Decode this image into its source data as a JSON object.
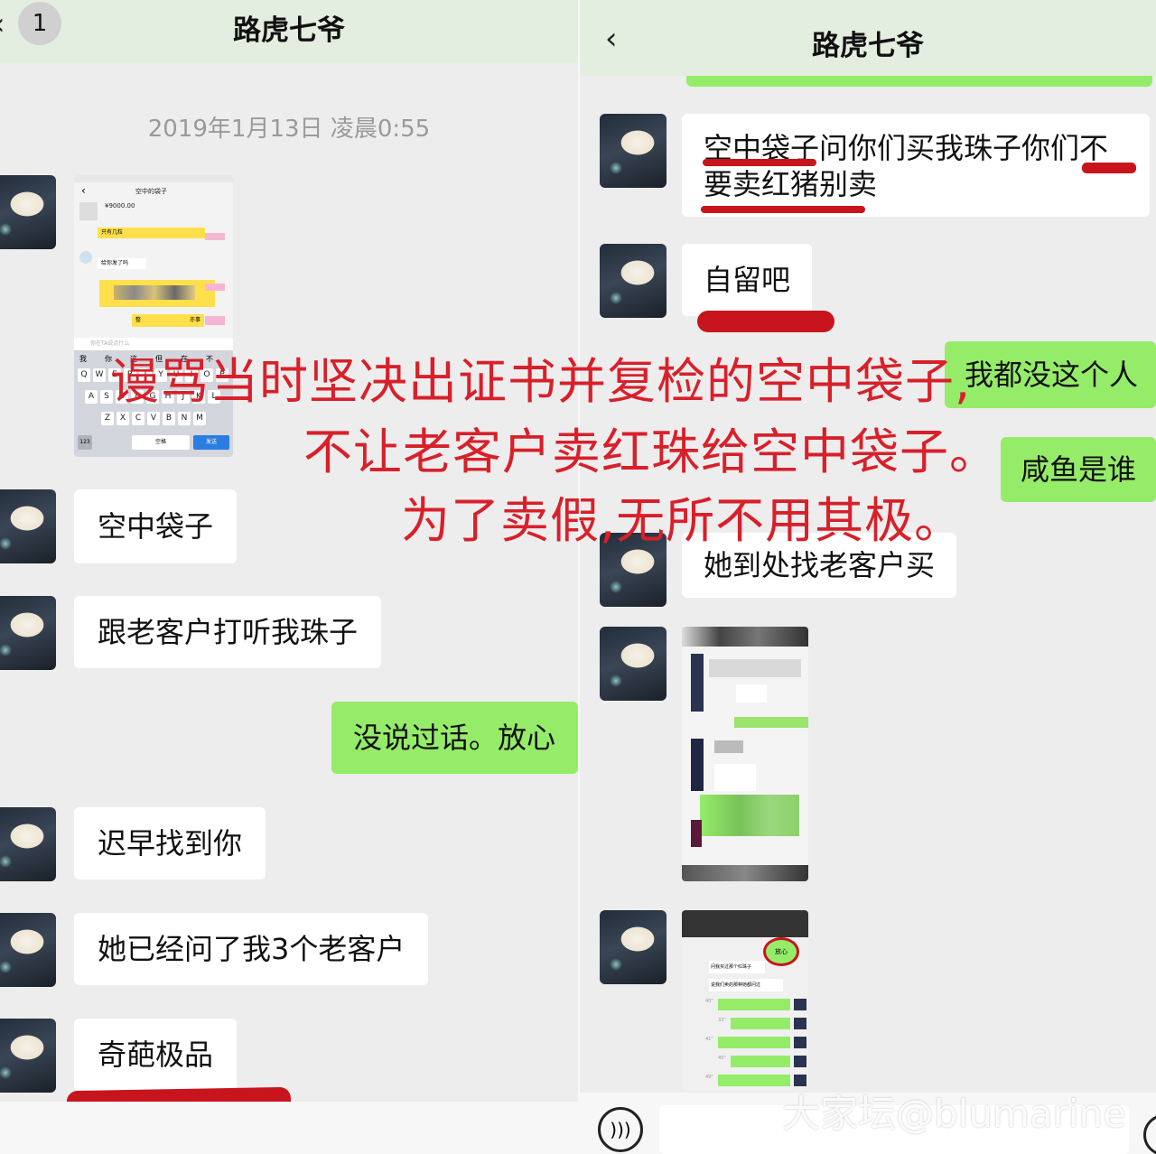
{
  "left_panel": {
    "title": "路虎七爷",
    "back_icon": "‹",
    "unread_badge": "1",
    "timestamp": "2019年1月13日 凌晨0:55",
    "screenshot_msg": {
      "title": "空中的袋子",
      "price": "¥9000.00",
      "bubble_1": "只有几粒",
      "bubble_2": "给你发了吗",
      "bubble_3": "整",
      "bubble_4": "亦事",
      "input_placeholder": "你在TA说点什么",
      "space_key": "空格",
      "send_key": "发送",
      "num_key": "123",
      "suggestions": [
        "我",
        "你",
        "这",
        "但",
        "在",
        "不"
      ],
      "row1": [
        "Q",
        "W",
        "E",
        "R",
        "T",
        "Y",
        "U",
        "I",
        "O",
        "P"
      ],
      "row2": [
        "A",
        "S",
        "D",
        "F",
        "G",
        "H",
        "J",
        "K",
        "L"
      ],
      "row3": [
        "Z",
        "X",
        "C",
        "V",
        "B",
        "N",
        "M"
      ]
    },
    "messages": [
      {
        "text": "空中袋子"
      },
      {
        "text": "跟老客户打听我珠子"
      },
      {
        "text": "没说过话。放心"
      },
      {
        "text": "迟早找到你"
      },
      {
        "text": "她已经问了我3个老客户"
      },
      {
        "text": "奇葩极品"
      }
    ]
  },
  "right_panel": {
    "title": "路虎七爷",
    "back_icon": "‹",
    "messages": [
      {
        "text": "空中袋子问你们买我珠子你们不要卖红猪别卖"
      },
      {
        "text": "自留吧"
      },
      {
        "text": "我都没这个人"
      },
      {
        "text": "咸鱼是谁"
      },
      {
        "text": "她到处找老客户买"
      }
    ],
    "image_2_labels": {
      "circle": "放心",
      "line_1": "问我买过那个红珠子",
      "line_2": "说我们卖的那种她都问过",
      "voice_lengths": [
        "40\"",
        "33\"",
        "41\"",
        "45\"",
        "49\""
      ]
    },
    "voice_icon": "voice-icon",
    "emoji_icon": "emoji-icon"
  },
  "overlay_annotation": {
    "line_1": "谩骂当时坚决出证书并复检的空中袋子,",
    "line_2": "不让老客户卖红珠给空中袋子。",
    "line_3": "为了卖假,无所不用其极。",
    "color": "#d8202a"
  },
  "watermark": "大家坛@blumarine",
  "colors": {
    "incoming_bubble": "#ffffff",
    "outgoing_bubble": "#95ec69",
    "background": "#ededed",
    "annotation_red": "#c8141c"
  }
}
